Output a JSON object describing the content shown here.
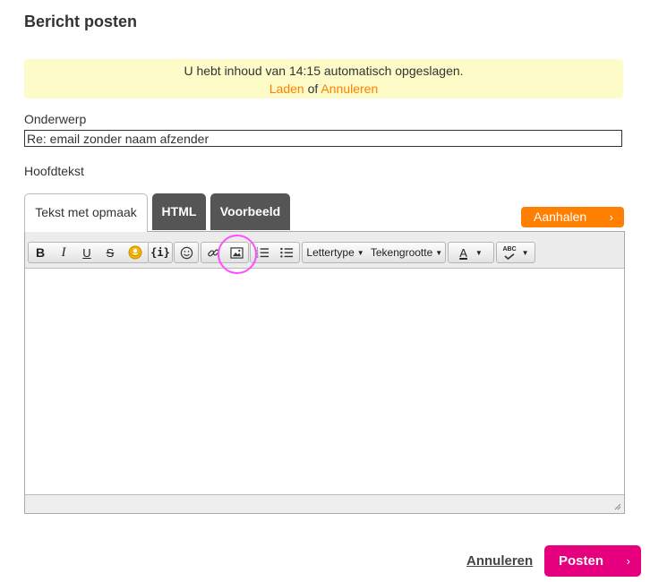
{
  "page": {
    "title": "Bericht posten"
  },
  "autosave": {
    "message": "U hebt inhoud van 14:15 automatisch opgeslagen.",
    "load_label": "Laden",
    "or_label": "of",
    "cancel_label": "Annuleren",
    "background": "#fdfbc7",
    "link_color": "#ff7f00"
  },
  "subject": {
    "label": "Onderwerp",
    "value": "Re: email zonder naam afzender"
  },
  "body": {
    "label": "Hoofdtekst",
    "value": ""
  },
  "tabs": [
    {
      "label": "Tekst met opmaak",
      "active": true
    },
    {
      "label": "HTML",
      "active": false
    },
    {
      "label": "Voorbeeld",
      "active": false
    }
  ],
  "quote_button": {
    "label": "Aanhalen",
    "icon": "chevron-right-icon"
  },
  "toolbar": {
    "bold": "B",
    "italic": "I",
    "underline": "U",
    "strike": "S",
    "code": "{i}",
    "font_label": "Lettertype",
    "size_label": "Tekengrootte",
    "color_label": "A",
    "spell_label": "ABC",
    "icons": [
      "bold-icon",
      "italic-icon",
      "underline-icon",
      "strikethrough-icon",
      "spoiler-icon",
      "code-icon",
      "emoji-icon",
      "link-icon",
      "image-icon",
      "ordered-list-icon",
      "unordered-list-icon",
      "spellcheck-icon"
    ]
  },
  "highlight": {
    "target": "image-icon",
    "color": "#ff4dff"
  },
  "actions": {
    "cancel_label": "Annuleren",
    "post_label": "Posten",
    "post_color": "#e6007e",
    "accent_color": "#ff7f00"
  }
}
